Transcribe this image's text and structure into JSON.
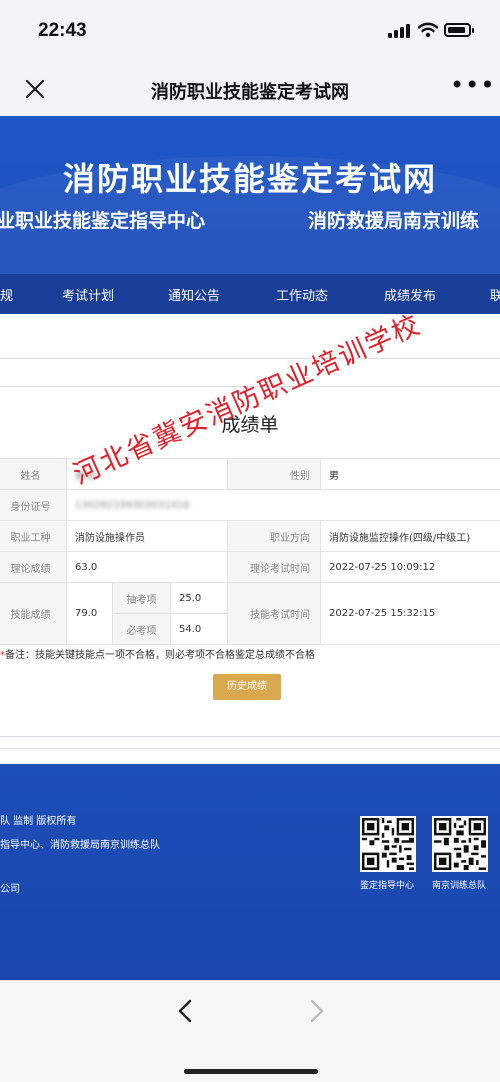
{
  "status": {
    "time": "22:43"
  },
  "nav": {
    "title": "消防职业技能鉴定考试网"
  },
  "banner": {
    "title": "消防职业技能鉴定考试网",
    "sub_left": "业职业技能鉴定指导中心",
    "sub_right": "消防救援局南京训练"
  },
  "menu": {
    "items": [
      "规",
      "考试计划",
      "通知公告",
      "工作动态",
      "成绩发布",
      "联"
    ]
  },
  "card": {
    "title": "成绩单",
    "labels": {
      "name": "姓名",
      "gender": "性别",
      "id": "身份证号",
      "job": "职业工种",
      "direction": "职业方向",
      "theory_score": "理论成绩",
      "theory_time": "理论考试时间",
      "skill_score": "技能成绩",
      "draw_item": "抽考项",
      "required_item": "必考项",
      "skill_time": "技能考试时间"
    },
    "values": {
      "name": "姜晓",
      "gender": "男",
      "id": "130282199303031418",
      "job": "消防设施操作员",
      "direction": "消防设施监控操作(四级/中级工)",
      "theory_score": "63.0",
      "theory_time": "2022-07-25 10:09:12",
      "skill_score": "79.0",
      "draw_item": "25.0",
      "required_item": "54.0",
      "skill_time": "2022-07-25 15:32:15"
    },
    "note_star": "*",
    "note": "备注：技能关键技能点一项不合格，则必考项不合格鉴定总成绩不合格",
    "history_button": "历史成绩"
  },
  "watermark": "河北省冀安消防职业培训学校",
  "footer": {
    "line1": "队 监制 版权所有",
    "line2": "指导中心、消防救援局南京训练总队",
    "line3": "公司",
    "qr1_label": "鉴定指导中心",
    "qr2_label": "南京训练总队"
  },
  "colors": {
    "banner": "#1d4db8",
    "menu": "#1a3f98",
    "button": "#d9a84f",
    "watermark": "#e0202a"
  },
  "icons": [
    "close-icon",
    "more-icon",
    "back-chevron-icon",
    "forward-chevron-icon",
    "signal-icon",
    "wifi-icon",
    "battery-icon"
  ]
}
